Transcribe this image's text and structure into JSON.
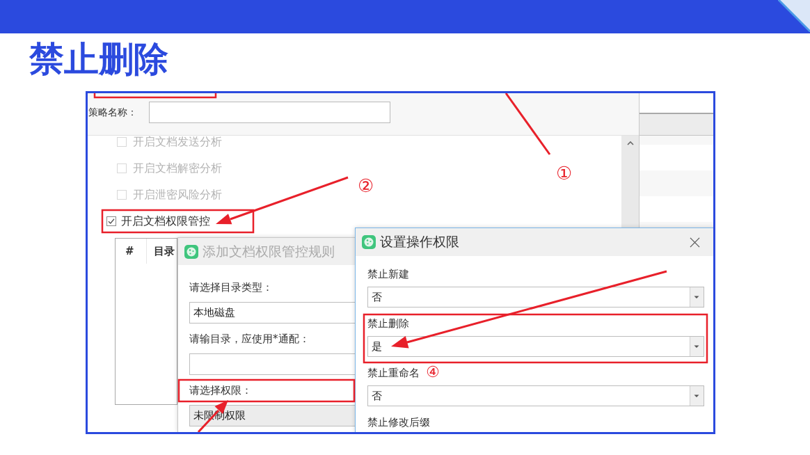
{
  "slide": {
    "title": "禁止删除"
  },
  "screenshot": {
    "policy_name": {
      "label": "策略名称："
    },
    "options": [
      {
        "label": "开启文档发送分析",
        "checked": false,
        "disabled": true
      },
      {
        "label": "开启文档解密分析",
        "checked": false,
        "disabled": true
      },
      {
        "label": "开启泄密风险分析",
        "checked": false,
        "disabled": true
      },
      {
        "label": "开启文档权限管控",
        "checked": true,
        "disabled": false
      }
    ],
    "table": {
      "columns": [
        "#",
        "目录"
      ]
    },
    "dialogs": [
      {
        "title": "添加文档权限管控规则",
        "active": false,
        "fields": [
          {
            "kind": "textbox",
            "label": "请选择目录类型：",
            "value": "本地磁盘",
            "disabled": false
          },
          {
            "kind": "textbox",
            "label": "请输目录，应使用*通配：",
            "disabled": false
          },
          {
            "kind": "textbox",
            "label": "请选择权限：",
            "value": "未限制权限",
            "disabled": true
          }
        ]
      },
      {
        "title": "设置操作权限",
        "active": true,
        "fields": [
          {
            "kind": "dropdown",
            "label": "禁止新建",
            "value": "否",
            "disabled": false
          },
          {
            "kind": "dropdown",
            "label": "禁止删除",
            "value": "是",
            "disabled": false
          },
          {
            "kind": "dropdown",
            "label": "禁止重命名",
            "value": "否",
            "disabled": false
          },
          {
            "kind": "label",
            "label": "禁止修改后缀",
            "disabled": false
          }
        ]
      }
    ]
  },
  "callouts": [
    "①",
    "②",
    "④"
  ]
}
